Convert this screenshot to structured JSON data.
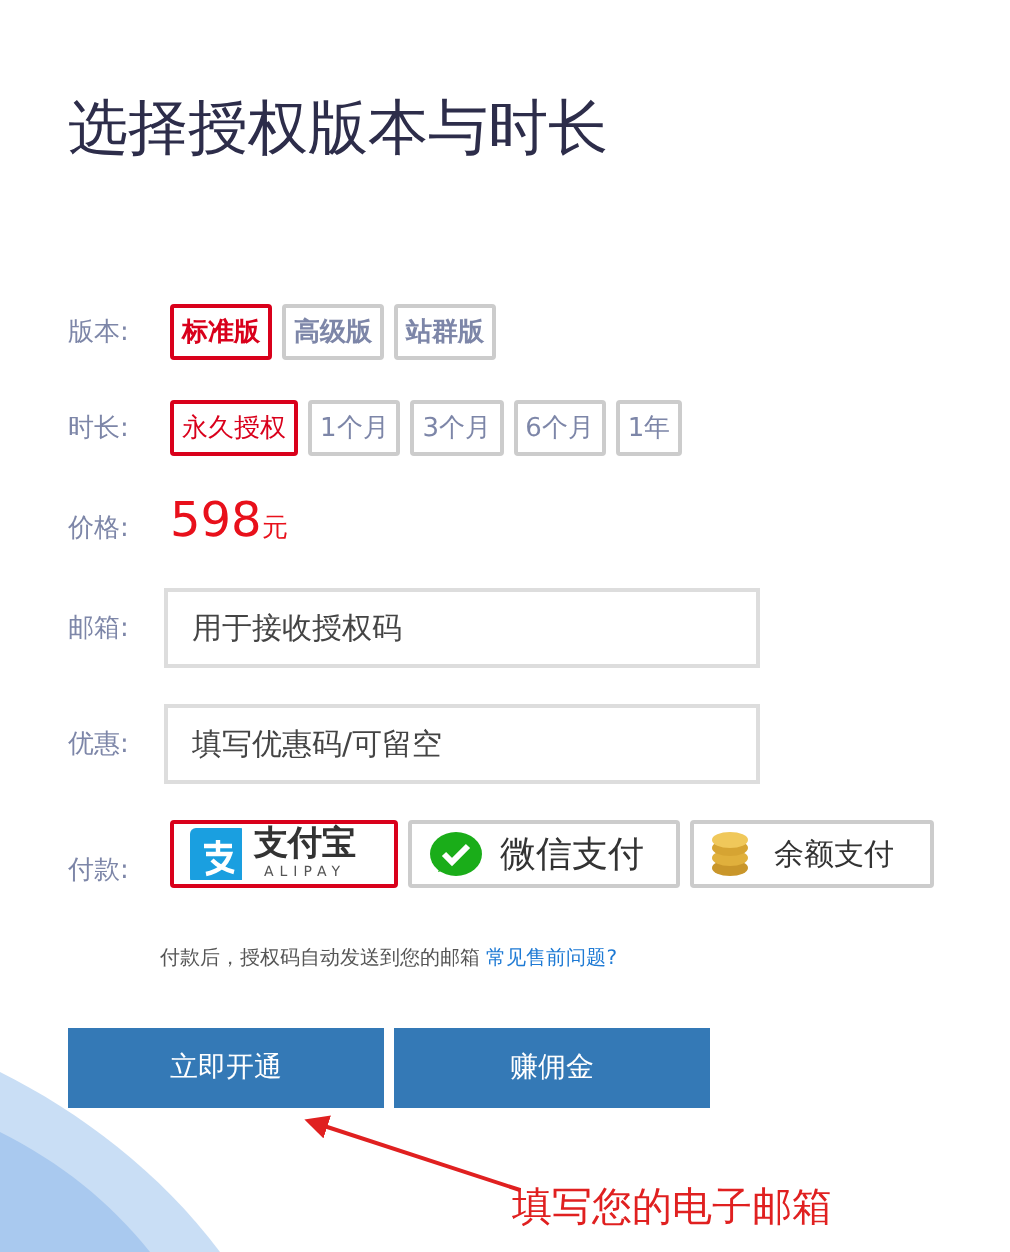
{
  "title": "选择授权版本与时长",
  "edition": {
    "label": "版本:",
    "options": [
      {
        "label": "标准版",
        "selected": true
      },
      {
        "label": "高级版",
        "selected": false
      },
      {
        "label": "站群版",
        "selected": false
      }
    ]
  },
  "duration": {
    "label": "时长:",
    "options": [
      {
        "label": "永久授权",
        "selected": true
      },
      {
        "label": "1个月",
        "selected": false
      },
      {
        "label": "3个月",
        "selected": false
      },
      {
        "label": "6个月",
        "selected": false
      },
      {
        "label": "1年",
        "selected": false
      }
    ]
  },
  "price": {
    "label": "价格:",
    "amount": "598",
    "unit": "元"
  },
  "email": {
    "label": "邮箱:",
    "placeholder": "用于接收授权码"
  },
  "coupon": {
    "label": "优惠:",
    "placeholder": "填写优惠码/可留空"
  },
  "payment": {
    "label": "付款:",
    "options": [
      {
        "kind": "alipay",
        "title": "支付宝",
        "subtitle": "ALIPAY",
        "selected": true
      },
      {
        "kind": "wechat",
        "title": "微信支付",
        "selected": false
      },
      {
        "kind": "balance",
        "title": "余额支付",
        "selected": false
      }
    ]
  },
  "note": {
    "text": "付款后，授权码自动发送到您的邮箱",
    "link": "常见售前问题?"
  },
  "buttons": [
    "立即开通",
    "赚佣金"
  ],
  "annotation": "填写您的电子邮箱"
}
